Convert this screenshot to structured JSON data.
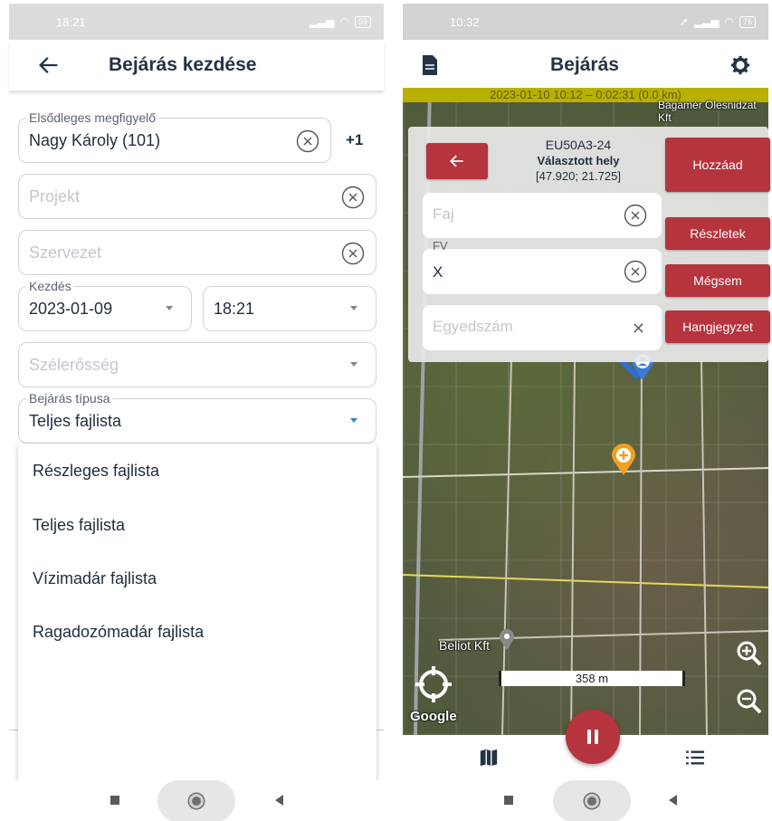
{
  "left": {
    "status": {
      "time": "18:21",
      "battery": "59"
    },
    "header": {
      "title": "Bejárás kezdése"
    },
    "observer": {
      "label": "Elsődleges megfigyelő",
      "value": "Nagy Károly (101)",
      "extra": "+1"
    },
    "project": {
      "placeholder": "Projekt"
    },
    "organization": {
      "placeholder": "Szervezet"
    },
    "start": {
      "label": "Kezdés",
      "date": "2023-01-09",
      "time": "18:21"
    },
    "wind": {
      "placeholder": "Szélerősség"
    },
    "survey_type": {
      "label": "Bejárás típusa",
      "value": "Teljes fajlista"
    },
    "menu": {
      "items": [
        "Részleges fajlista",
        "Teljes fajlista",
        "Vízimadár fajlista",
        "Ragadozómadár fajlista"
      ]
    }
  },
  "right": {
    "status": {
      "time": "10:32",
      "battery": "76"
    },
    "header": {
      "title": "Bejárás"
    },
    "trip": {
      "info": "2023-01-10 10:12 – 0:02:31 (0.0 km)"
    },
    "location": {
      "code": "EU50A3-24",
      "title": "Választott hely",
      "coords": "[47.920; 21.725]"
    },
    "fields": {
      "species_placeholder": "Faj",
      "fv_label": "FV",
      "fv_value": "X",
      "count_placeholder": "Egyedszám"
    },
    "buttons": {
      "add": "Hozzáad",
      "details": "Részletek",
      "cancel": "Mégsem",
      "voice": "Hangjegyzet"
    },
    "map": {
      "poi": "Beliot Kft",
      "scale": "358 m",
      "attribution": "Google",
      "top_label": "Bagamér Olesnidzat Kft"
    }
  },
  "colors": {
    "accent_red": "#b5343d",
    "text_dark": "#1f2d3d",
    "trip_bar": "#b9b100"
  },
  "icons": [
    "back-arrow-icon",
    "clear-icon",
    "dropdown-caret-icon",
    "document-icon",
    "gear-icon",
    "zoom-in-icon",
    "zoom-out-icon",
    "locate-icon",
    "pause-icon",
    "map-icon",
    "list-icon",
    "location-pin-icon",
    "add-pin-icon"
  ]
}
